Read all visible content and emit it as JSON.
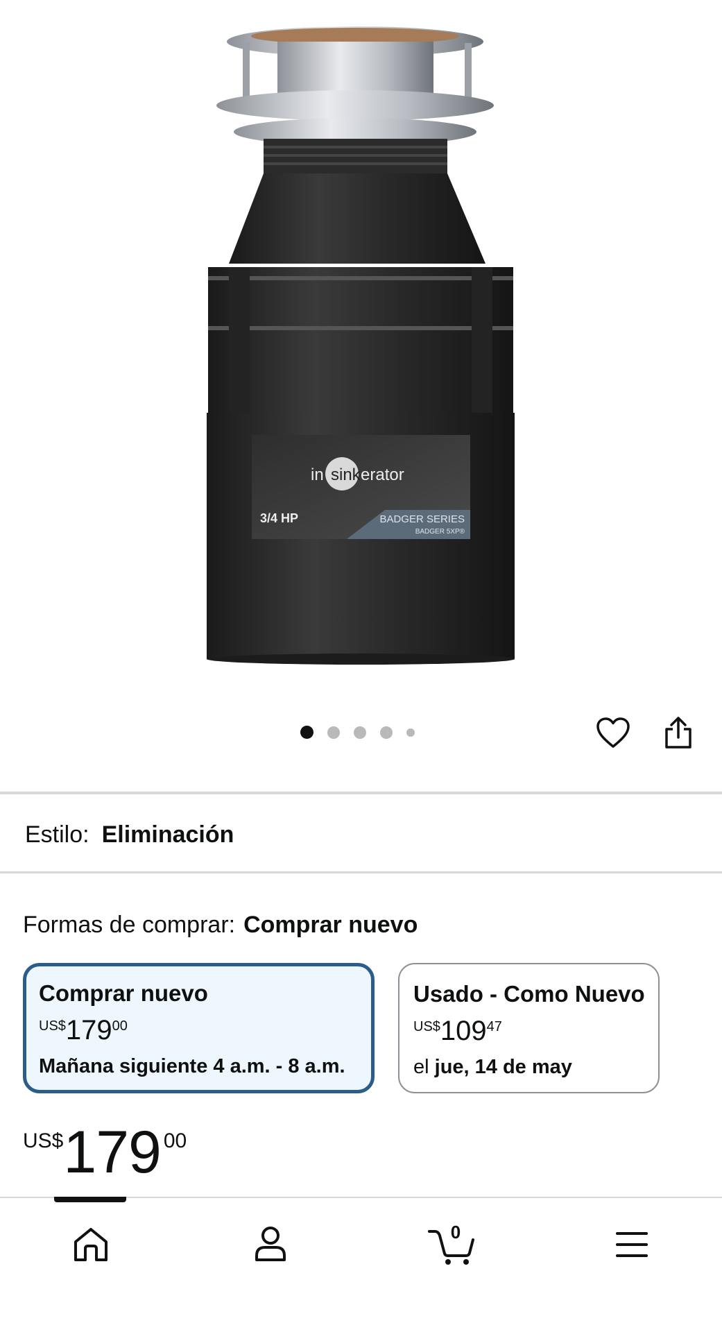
{
  "product_image": {
    "brand": "insinkerator",
    "power": "3/4 HP",
    "series": "BADGER SERIES",
    "model": "BADGER 5XP®"
  },
  "carousel": {
    "total": 5,
    "active": 1
  },
  "style": {
    "label": "Estilo:",
    "value": "Eliminación"
  },
  "buy_options": {
    "label": "Formas de comprar:",
    "selected_value": "Comprar nuevo",
    "options": [
      {
        "title": "Comprar nuevo",
        "currency": "US$",
        "whole": "179",
        "fraction": "00",
        "delivery_prefix": "",
        "delivery": "Mañana siguiente 4 a.m. - 8 a.m."
      },
      {
        "title": "Usado - Como Nuevo",
        "currency": "US$",
        "whole": "109",
        "fraction": "47",
        "delivery_prefix": "el ",
        "delivery": "jue, 14 de may"
      }
    ]
  },
  "price": {
    "currency": "US$",
    "whole": "179",
    "fraction": "00"
  },
  "cart": {
    "count": "0"
  },
  "icons": {
    "wishlist": "heart-icon",
    "share": "share-icon",
    "home": "home-icon",
    "account": "account-icon",
    "cart": "cart-icon",
    "menu": "menu-icon"
  },
  "colors": {
    "selected_border": "#2b5d8a",
    "selected_bg": "#edf7fd",
    "divider": "#d5d9d9"
  }
}
